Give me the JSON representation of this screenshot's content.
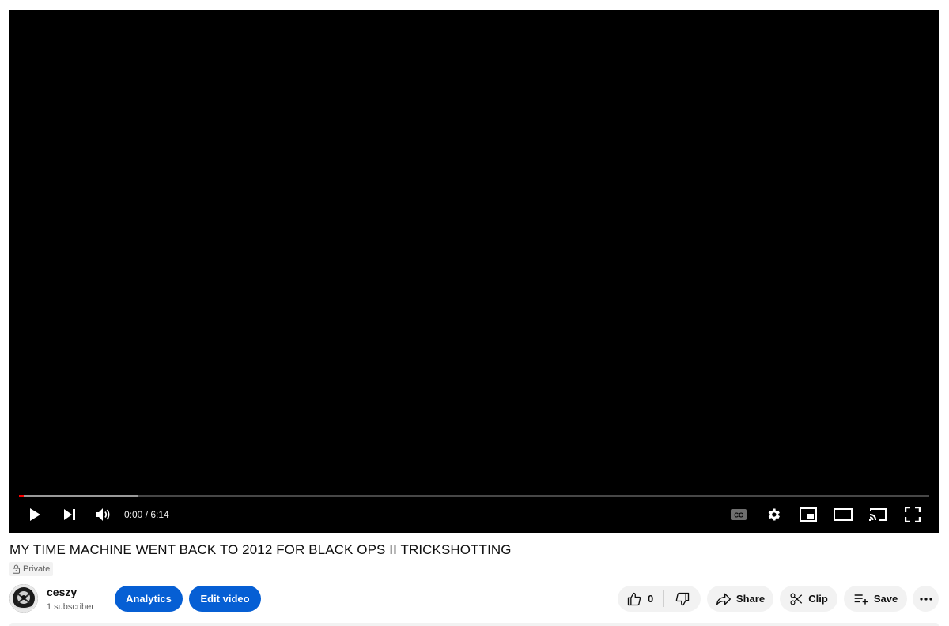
{
  "player": {
    "time_display": "0:00 / 6:14",
    "progress_played": 0.005,
    "progress_buffered": 0.13,
    "icons": [
      "play-icon",
      "next-icon",
      "volume-icon",
      "captions-icon",
      "settings-icon",
      "miniplayer-icon",
      "theater-mode-icon",
      "cast-icon",
      "fullscreen-icon"
    ],
    "accent_color": "#ff0000"
  },
  "video": {
    "title": "MY TIME MACHINE WENT BACK TO 2012 FOR BLACK OPS II TRICKSHOTTING",
    "visibility": "Private"
  },
  "channel": {
    "name": "ceszy",
    "subscribers": "1 subscriber"
  },
  "actions": {
    "analytics_label": "Analytics",
    "edit_label": "Edit video",
    "like_count": "0",
    "share_label": "Share",
    "clip_label": "Clip",
    "save_label": "Save",
    "brand_blue": "#065fd4"
  }
}
